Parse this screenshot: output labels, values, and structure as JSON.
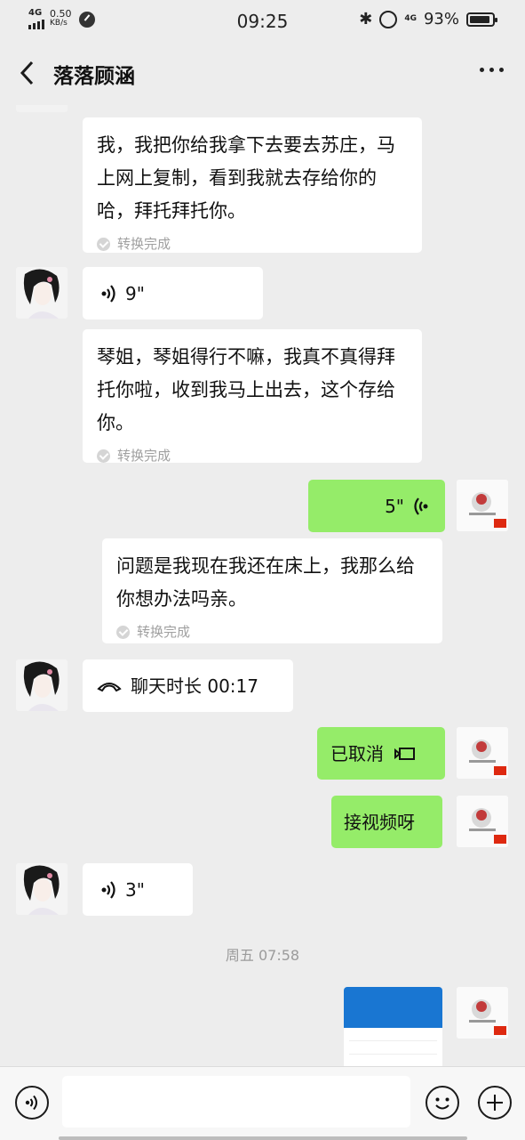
{
  "status_bar": {
    "network": "4G",
    "speed_value": "0.50",
    "speed_unit": "KB/s",
    "time": "09:25",
    "network_right": "4G",
    "battery": "93%",
    "battery_level": 0.93
  },
  "header": {
    "title": "落落顾涵"
  },
  "messages": [
    {
      "type": "voice-transcription",
      "text": "我，我把你给我拿下去要去苏庄，马上网上复制，看到我就去存给你的哈，拜托拜托你。",
      "status": "转换完成"
    },
    {
      "type": "voice",
      "duration": "9\""
    },
    {
      "type": "voice-transcription",
      "text": "琴姐，琴姐得行不嘛，我真不真得拜托你啦，收到我马上出去，这个存给你。",
      "status": "转换完成"
    },
    {
      "type": "voice-out",
      "duration": "5\""
    },
    {
      "type": "voice-transcription",
      "text": "问题是我现在我还在床上，我那么给你想办法吗亲。",
      "status": "转换完成"
    },
    {
      "type": "call",
      "text": "聊天时长 00:17"
    },
    {
      "type": "video-cancelled",
      "text": "已取消"
    },
    {
      "type": "text-out",
      "text": "接视频呀"
    },
    {
      "type": "voice",
      "duration": "3\""
    },
    {
      "type": "timestamp",
      "text": "周五 07:58"
    }
  ],
  "colors": {
    "background": "#ededed",
    "outgoing_bubble": "#95ec69",
    "incoming_bubble": "#ffffff"
  },
  "input": {
    "value": "",
    "placeholder": ""
  }
}
